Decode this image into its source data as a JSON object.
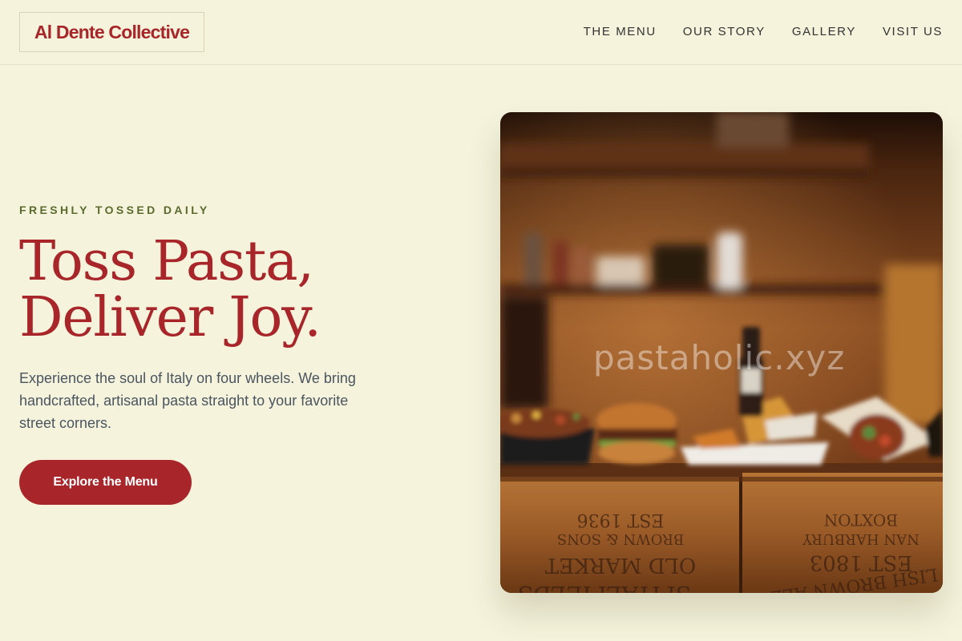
{
  "brand": {
    "name": "Al Dente Collective"
  },
  "nav": {
    "items": [
      {
        "label": "THE MENU"
      },
      {
        "label": "OUR STORY"
      },
      {
        "label": "GALLERY"
      },
      {
        "label": "VISIT US"
      }
    ]
  },
  "hero": {
    "eyebrow": "FRESHLY TOSSED DAILY",
    "headline_line1": "Toss Pasta,",
    "headline_line2": "Deliver Joy.",
    "lead": "Experience the soul of Italy on four wheels. We bring handcrafted, artisanal pasta straight to your favorite street corners.",
    "cta_label": "Explore the Menu",
    "watermark": "pastaholic.xyz",
    "image_alt": "Street food dishes on wooden crates",
    "crate_left": {
      "l1": "EST 1936",
      "l2": "BROWN & SONS",
      "l3": "OLD MARKET",
      "l4": "SPITALFIELDS"
    },
    "crate_right": {
      "l1": "BOXTON",
      "l2": "NAN HARBURY",
      "l3": "EST 1803",
      "l4": "LISH BROWN ALE"
    }
  },
  "colors": {
    "background": "#f5f3dc",
    "brand_red": "#a8262a",
    "eyebrow_green": "#5a6b2d",
    "body_text": "#4a5560"
  }
}
